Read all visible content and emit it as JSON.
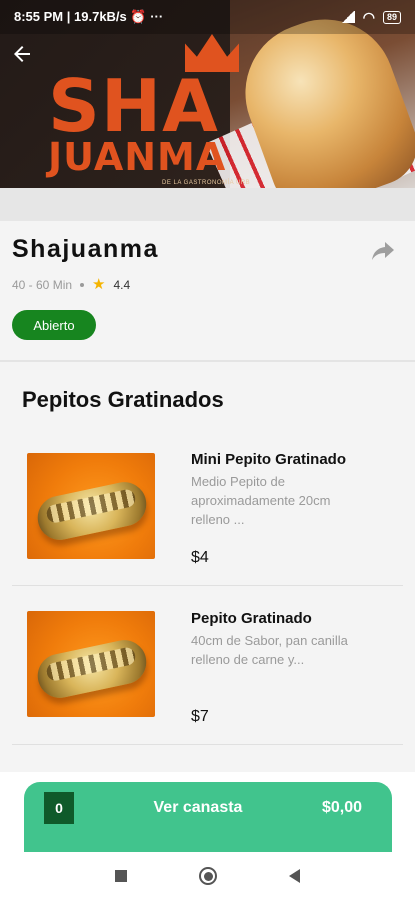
{
  "status_bar": {
    "time": "8:55 PM",
    "speed": "19.7kB/s",
    "extra": "⏰ ···",
    "battery": "89"
  },
  "hero": {
    "logo_line1": "SHA",
    "logo_line2": "JUANMA",
    "logo_tagline": "DE LA GASTRONOMÍA URB"
  },
  "restaurant": {
    "name": "Shajuanma",
    "delivery_time": "40 - 60 Min",
    "rating": "4.4",
    "status": "Abierto",
    "status_color": "#17851f"
  },
  "section": {
    "title": "Pepitos Gratinados",
    "items": [
      {
        "name": "Mini Pepito Gratinado",
        "description": "Medio Pepito de aproximadamente 20cm relleno ...",
        "price": "$4"
      },
      {
        "name": "Pepito Gratinado",
        "description": "40cm de Sabor, pan canilla relleno de carne y...",
        "price": "$7"
      }
    ]
  },
  "cart": {
    "count": "0",
    "label": "Ver canasta",
    "total": "$0,00",
    "color": "#41c48d"
  },
  "icons": {
    "back": "arrow-left-icon",
    "share": "share-icon",
    "star": "star-icon"
  }
}
